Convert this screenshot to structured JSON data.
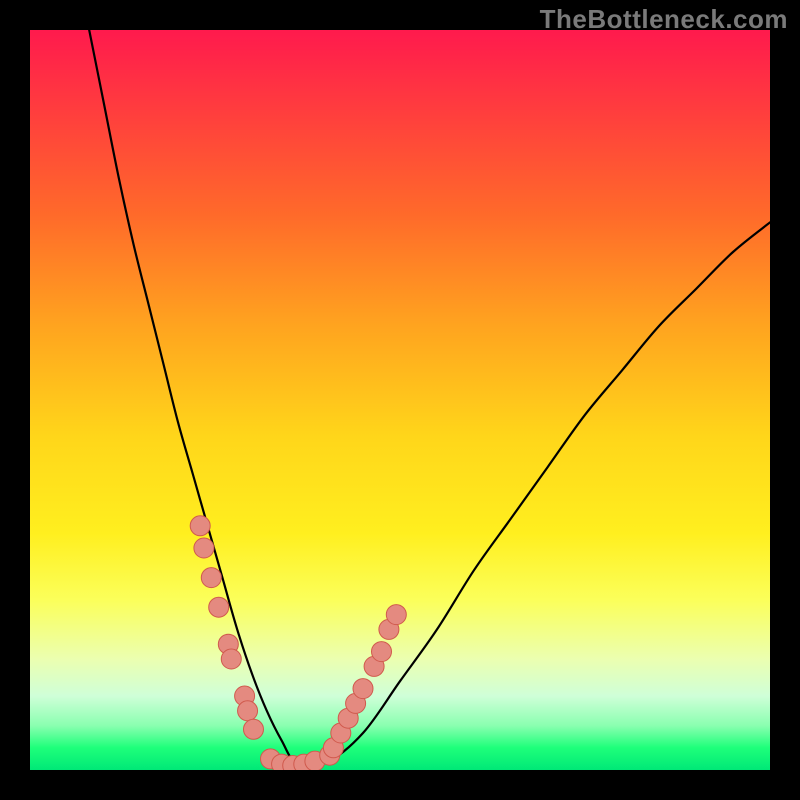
{
  "watermark": "TheBottleneck.com",
  "chart_data": {
    "type": "line",
    "title": "",
    "xlabel": "",
    "ylabel": "",
    "xlim": [
      0,
      100
    ],
    "ylim": [
      0,
      100
    ],
    "series": [
      {
        "name": "curve",
        "x": [
          8,
          10,
          12,
          14,
          16,
          18,
          20,
          22,
          24,
          26,
          28,
          30,
          32,
          34,
          36,
          40,
          45,
          50,
          55,
          60,
          65,
          70,
          75,
          80,
          85,
          90,
          95,
          100
        ],
        "y": [
          100,
          90,
          80,
          71,
          63,
          55,
          47,
          40,
          33,
          26,
          19,
          13,
          8,
          4,
          1,
          1,
          5,
          12,
          19,
          27,
          34,
          41,
          48,
          54,
          60,
          65,
          70,
          74
        ]
      }
    ],
    "markers": [
      {
        "name": "cluster-left",
        "x": [
          23.0,
          23.5,
          24.5,
          25.5,
          26.8,
          27.2,
          29.0,
          29.4,
          30.2
        ],
        "y": [
          33.0,
          30.0,
          26.0,
          22.0,
          17.0,
          15.0,
          10.0,
          8.0,
          5.5
        ]
      },
      {
        "name": "cluster-bottom",
        "x": [
          32.5,
          34.0,
          35.5,
          37.0,
          38.5
        ],
        "y": [
          1.5,
          0.8,
          0.6,
          0.8,
          1.2
        ]
      },
      {
        "name": "cluster-right",
        "x": [
          40.5,
          41.0,
          42.0,
          43.0,
          44.0,
          45.0,
          46.5,
          47.5,
          48.5,
          49.5
        ],
        "y": [
          2.0,
          3.0,
          5.0,
          7.0,
          9.0,
          11.0,
          14.0,
          16.0,
          19.0,
          21.0
        ]
      }
    ],
    "colors": {
      "curve": "#000000",
      "marker_fill": "#e48a80",
      "marker_stroke": "#d05a4d",
      "background_top": "#ff1a4d",
      "background_bottom": "#00e877"
    }
  }
}
